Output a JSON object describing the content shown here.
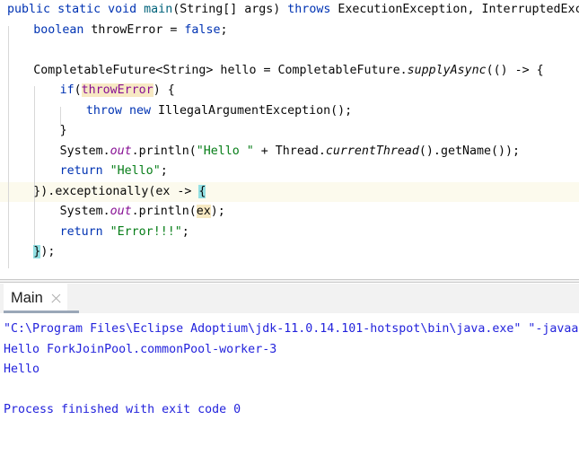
{
  "editor": {
    "name": "java-code-editor",
    "language": "Java",
    "caret_line_index": 9,
    "lines": [
      {
        "indent": 0,
        "tokens": [
          {
            "t": "public",
            "c": "kw"
          },
          {
            "t": " ",
            "c": "pl"
          },
          {
            "t": "static",
            "c": "kw"
          },
          {
            "t": " ",
            "c": "pl"
          },
          {
            "t": "void",
            "c": "kw"
          },
          {
            "t": " ",
            "c": "pl"
          },
          {
            "t": "main",
            "c": "mdecl"
          },
          {
            "t": "(String[] args) ",
            "c": "pl"
          },
          {
            "t": "throws",
            "c": "kw"
          },
          {
            "t": " ExecutionException, InterruptedException {",
            "c": "pl"
          }
        ]
      },
      {
        "indent": 1,
        "tokens": [
          {
            "t": "boolean",
            "c": "kw"
          },
          {
            "t": " throwError = ",
            "c": "pl"
          },
          {
            "t": "false",
            "c": "kw"
          },
          {
            "t": ";",
            "c": "pl"
          }
        ]
      },
      {
        "indent": 1,
        "tokens": []
      },
      {
        "indent": 1,
        "tokens": [
          {
            "t": "CompletableFuture<String> hello = CompletableFuture.",
            "c": "pl"
          },
          {
            "t": "supplyAsync",
            "c": "stm"
          },
          {
            "t": "(() -> {",
            "c": "pl"
          }
        ]
      },
      {
        "indent": 2,
        "tokens": [
          {
            "t": "if",
            "c": "kw"
          },
          {
            "t": "(",
            "c": "pl"
          },
          {
            "t": "throwError",
            "c": "field",
            "hl": "ident"
          },
          {
            "t": ") {",
            "c": "pl"
          }
        ]
      },
      {
        "indent": 3,
        "tokens": [
          {
            "t": "throw",
            "c": "kw"
          },
          {
            "t": " ",
            "c": "pl"
          },
          {
            "t": "new",
            "c": "kw"
          },
          {
            "t": " IllegalArgumentException();",
            "c": "pl"
          }
        ]
      },
      {
        "indent": 2,
        "tokens": [
          {
            "t": "}",
            "c": "pl"
          }
        ]
      },
      {
        "indent": 2,
        "tokens": [
          {
            "t": "System.",
            "c": "pl"
          },
          {
            "t": "out",
            "c": "fieldi"
          },
          {
            "t": ".println(",
            "c": "pl"
          },
          {
            "t": "\"Hello \"",
            "c": "str"
          },
          {
            "t": " + Thread.",
            "c": "pl"
          },
          {
            "t": "currentThread",
            "c": "stm"
          },
          {
            "t": "().getName());",
            "c": "pl"
          }
        ]
      },
      {
        "indent": 2,
        "tokens": [
          {
            "t": "return",
            "c": "kw"
          },
          {
            "t": " ",
            "c": "pl"
          },
          {
            "t": "\"Hello\"",
            "c": "str"
          },
          {
            "t": ";",
            "c": "pl"
          }
        ]
      },
      {
        "indent": 1,
        "tokens": [
          {
            "t": "}).exceptionally(ex -> ",
            "c": "pl"
          },
          {
            "t": "{",
            "c": "pl",
            "hl": "brace"
          }
        ]
      },
      {
        "indent": 2,
        "tokens": [
          {
            "t": "System.",
            "c": "pl"
          },
          {
            "t": "out",
            "c": "fieldi"
          },
          {
            "t": ".println(",
            "c": "pl"
          },
          {
            "t": "ex",
            "c": "pl",
            "hl": "ident"
          },
          {
            "t": ");",
            "c": "pl"
          }
        ]
      },
      {
        "indent": 2,
        "tokens": [
          {
            "t": "return",
            "c": "kw"
          },
          {
            "t": " ",
            "c": "pl"
          },
          {
            "t": "\"Error!!!\"",
            "c": "str"
          },
          {
            "t": ";",
            "c": "pl"
          }
        ]
      },
      {
        "indent": 1,
        "tokens": [
          {
            "t": "}",
            "c": "pl",
            "hl": "brace"
          },
          {
            "t": ");",
            "c": "pl"
          }
        ]
      }
    ]
  },
  "console": {
    "tab": {
      "label": "Main",
      "close_icon": "close-icon",
      "active": true
    },
    "output_lines": [
      "\"C:\\Program Files\\Eclipse Adoptium\\jdk-11.0.14.101-hotspot\\bin\\java.exe\" \"-javaagent:C:\\Pro",
      "Hello ForkJoinPool.commonPool-worker-3",
      "Hello",
      "",
      "Process finished with exit code 0"
    ]
  },
  "colors": {
    "editor_background": "#ffffff",
    "caret_line_background": "#fcfaed",
    "keyword": "#0033b3",
    "string": "#067d17",
    "static_field": "#871094",
    "method_declaration": "#00627a",
    "identifier_highlight": "#f7e9c3",
    "brace_match_highlight": "#93e0e3",
    "console_text": "#2323dc",
    "tabbar_background": "#f2f2f2",
    "active_tab_underline": "#9aa7b8",
    "indent_guide": "#d8d8d8"
  }
}
